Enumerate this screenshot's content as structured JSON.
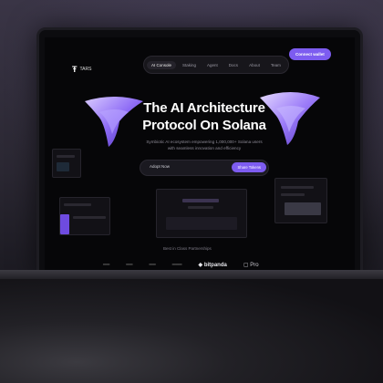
{
  "nav": {
    "logo_text": "TARS",
    "tabs": [
      "AI Console",
      "Staking",
      "Agent",
      "Docs",
      "About",
      "Team"
    ],
    "active_tab": "AI Console",
    "connect_label": "Connect wallet"
  },
  "hero": {
    "title": "The AI Architecture Protocol On Solana",
    "subtitle": "Symbiotic AI ecosystem empowering 1,000,000+ Solana users with seamless innovation and efficiency",
    "adopt_label": "Adopt Now",
    "share_label": "Share Tokens"
  },
  "partners": {
    "heading": "Best in Class Partnerships",
    "logos": [
      "bitpanda",
      "Pro"
    ]
  },
  "colors": {
    "accent": "#7d5cf0",
    "background": "#060608"
  }
}
